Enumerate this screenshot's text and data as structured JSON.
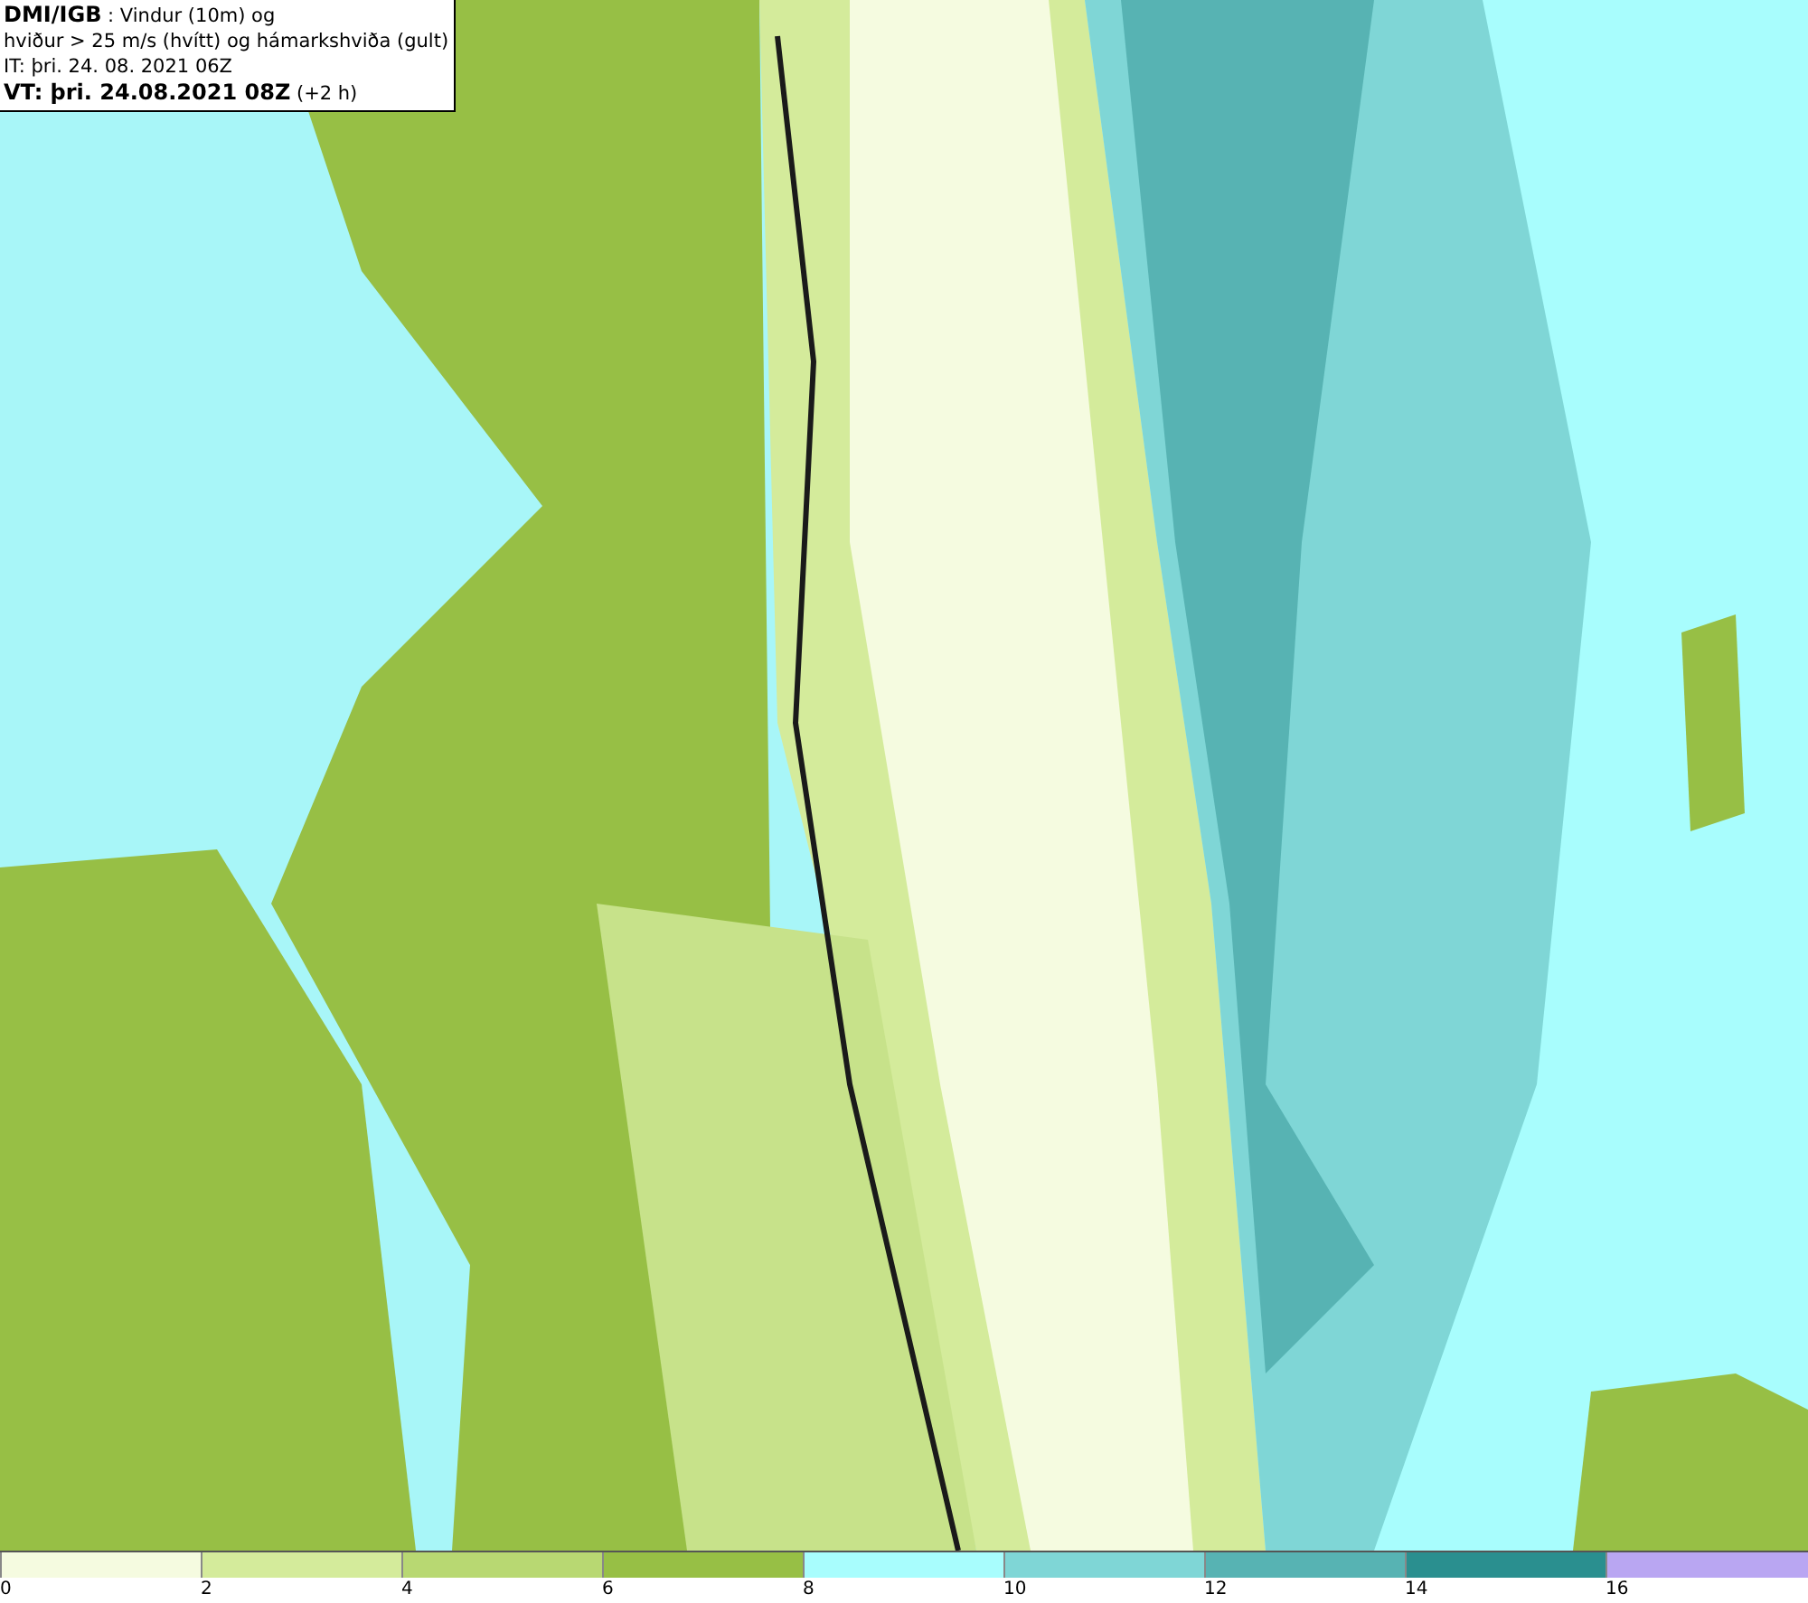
{
  "header": {
    "lines": [
      "**DMI/IGB** : Vindur (10m) og",
      "hviður > 25 m/s (hvítt) og hámarkshviða (gult)",
      "IT: þri. 24. 08. 2021 06Z",
      "**VT: þri. 24.08.2021 08Z** (+2 h)"
    ]
  },
  "legend": {
    "bins": [
      {
        "label": "0",
        "color": "#f5fbe0"
      },
      {
        "label": "2",
        "color": "#d4eb9b"
      },
      {
        "label": "4",
        "color": "#b8d872"
      },
      {
        "label": "6",
        "color": "#97bf45"
      },
      {
        "label": "8",
        "color": "#a8fdfd"
      },
      {
        "label": "10",
        "color": "#7fd6d6"
      },
      {
        "label": "12",
        "color": "#57b3b3"
      },
      {
        "label": "14",
        "color": "#2a8f8f"
      },
      {
        "label": "16",
        "color": "#b9a6f2"
      }
    ]
  }
}
